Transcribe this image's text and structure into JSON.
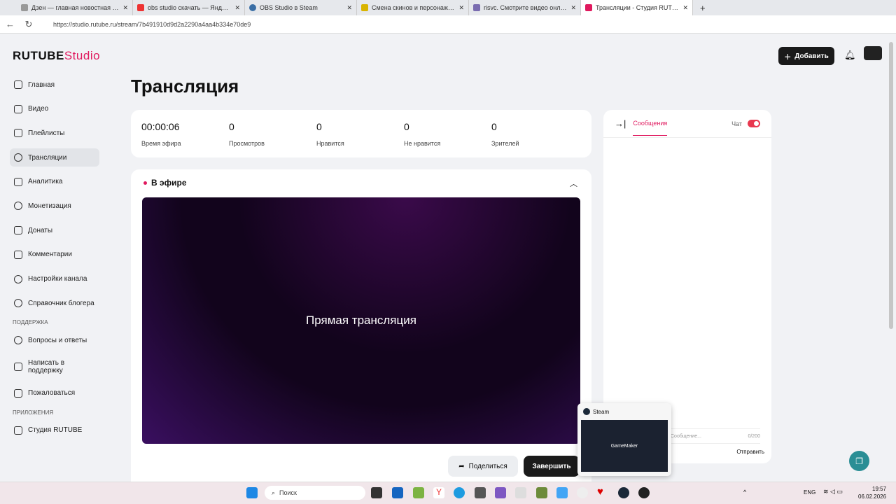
{
  "browser": {
    "tabs": [
      "Дзен — главная новостная инф",
      "obs studio скачать — Яндекс на",
      "OBS Studio в Steam",
      "Смена скинов и персонажей в",
      "risvc. Смотрите видео онлайн, б",
      "Трансляции - Студия RUTUBE"
    ],
    "url": "https://studio.rutube.ru/stream/7b491910d9d2a2290a4aa4b334e70de9"
  },
  "logo": {
    "brand": "RUTUBE",
    "product": "Studio"
  },
  "sidebar": {
    "items": [
      "Главная",
      "Видео",
      "Плейлисты",
      "Трансляции",
      "Аналитика",
      "Монетизация",
      "Донаты",
      "Комментарии",
      "Настройки канала",
      "Справочник блогера"
    ],
    "support_title": "ПОДДЕРЖКА",
    "support": [
      "Вопросы и ответы",
      "Написать в поддержку",
      "Пожаловаться"
    ],
    "apps_title": "ПРИЛОЖЕНИЯ",
    "apps": [
      "Студия RUTUBE"
    ]
  },
  "header": {
    "add_label": "Добавить"
  },
  "page_title": "Трансляция",
  "stats": [
    {
      "value": "00:00:06",
      "label": "Время эфира"
    },
    {
      "value": "0",
      "label": "Просмотров"
    },
    {
      "value": "0",
      "label": "Нравится"
    },
    {
      "value": "0",
      "label": "Не нравится"
    },
    {
      "value": "0",
      "label": "Зрителей"
    }
  ],
  "live": {
    "status": "В эфире",
    "player_text": "Прямая трансляция",
    "share_label": "Поделиться",
    "finish_label": "Завершить"
  },
  "chat": {
    "tab": "Сообщения",
    "toggle_label": "Чат",
    "placeholder": "Сообщение...",
    "counter": "0/200",
    "send_label": "Отправить"
  },
  "popup": {
    "title": "Steam",
    "thumb_text": "GameMaker"
  },
  "taskbar": {
    "search": "Поиск",
    "lang": "ENG",
    "time": "19:57",
    "date": "06.02.2026"
  }
}
